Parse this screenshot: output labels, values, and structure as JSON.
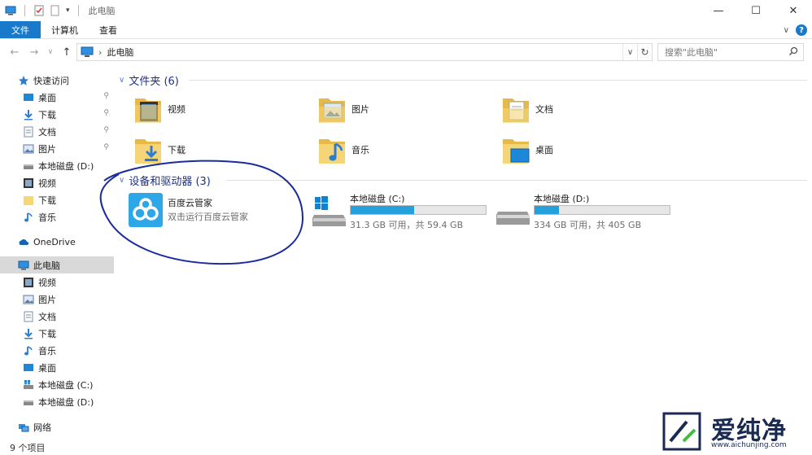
{
  "window": {
    "title": "此电脑",
    "buttons": {
      "minimize": "—",
      "maximize": "☐",
      "close": "✕"
    }
  },
  "ribbon": {
    "tabs": [
      {
        "label": "文件",
        "active": true
      },
      {
        "label": "计算机",
        "active": false
      },
      {
        "label": "查看",
        "active": false
      }
    ],
    "help": "?"
  },
  "navigation": {
    "back": "←",
    "forward": "→",
    "recent": "∨",
    "up": "↑",
    "address": "此电脑",
    "address_chevron": "›",
    "dropdown": "∨",
    "refresh": "↻",
    "search_placeholder": "搜索\"此电脑\""
  },
  "sidebar": {
    "quick_access": {
      "label": "快速访问",
      "items": [
        {
          "label": "桌面",
          "pinned": true
        },
        {
          "label": "下载",
          "pinned": true
        },
        {
          "label": "文档",
          "pinned": true
        },
        {
          "label": "图片",
          "pinned": true
        },
        {
          "label": "本地磁盘 (D:)",
          "pinned": false
        },
        {
          "label": "视频",
          "pinned": false
        },
        {
          "label": "下载",
          "pinned": false
        },
        {
          "label": "音乐",
          "pinned": false
        }
      ]
    },
    "onedrive": "OneDrive",
    "this_pc": {
      "label": "此电脑",
      "selected": true,
      "items": [
        "视频",
        "图片",
        "文档",
        "下载",
        "音乐",
        "桌面",
        "本地磁盘 (C:)",
        "本地磁盘 (D:)"
      ]
    },
    "network": "网络",
    "pin_glyph": "📌"
  },
  "main": {
    "folders_header": "文件夹 (6)",
    "folders": [
      "视频",
      "图片",
      "文档",
      "下载",
      "音乐",
      "桌面"
    ],
    "devices_header": "设备和驱动器 (3)",
    "app": {
      "name": "百度云管家",
      "subtitle": "双击运行百度云管家"
    },
    "drives": [
      {
        "name": "本地磁盘 (C:)",
        "free": "31.3 GB 可用，共 59.4 GB",
        "used_fraction": 0.47
      },
      {
        "name": "本地磁盘 (D:)",
        "free": "334 GB 可用，共 405 GB",
        "used_fraction": 0.18
      }
    ]
  },
  "status": {
    "count": "9 个项目"
  },
  "watermark": {
    "brand": "爱纯净",
    "url": "www.aichunjing.com"
  },
  "colors": {
    "accent": "#1979ca",
    "drive_fill": "#26a0da",
    "group_header": "#1e3287",
    "annotation": "#1a2b9e"
  }
}
